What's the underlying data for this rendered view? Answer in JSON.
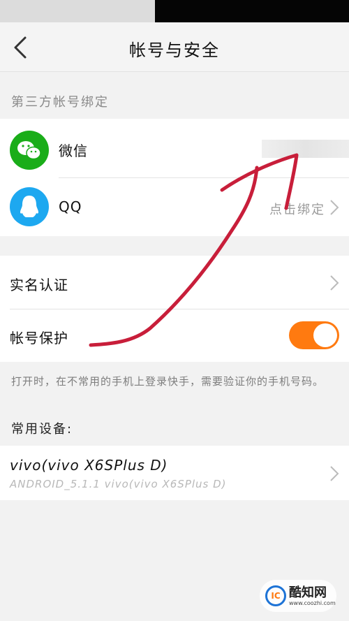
{
  "header": {
    "title": "帐号与安全"
  },
  "third_party": {
    "section_label": "第三方帐号绑定",
    "items": [
      {
        "name": "微信",
        "icon": "wechat-icon",
        "color": "#1aad19"
      },
      {
        "name": "QQ",
        "icon": "qq-icon",
        "color": "#1da8f0",
        "action": "点击绑定"
      }
    ]
  },
  "security": {
    "real_name_label": "实名认证",
    "protection_label": "帐号保护",
    "protection_on": true,
    "toggle_color": "#ff7a10",
    "hint": "打开时，在不常用的手机上登录快手，需要验证你的手机号码。"
  },
  "devices": {
    "section_label": "常用设备:",
    "items": [
      {
        "name": "vivo(vivo X6SPlus D)",
        "detail": "ANDROID_5.1.1 vivo(vivo X6SPlus D)"
      }
    ]
  },
  "watermark": {
    "name": "酷知网",
    "url": "www.coozhi.com",
    "logo_text": "IC"
  }
}
